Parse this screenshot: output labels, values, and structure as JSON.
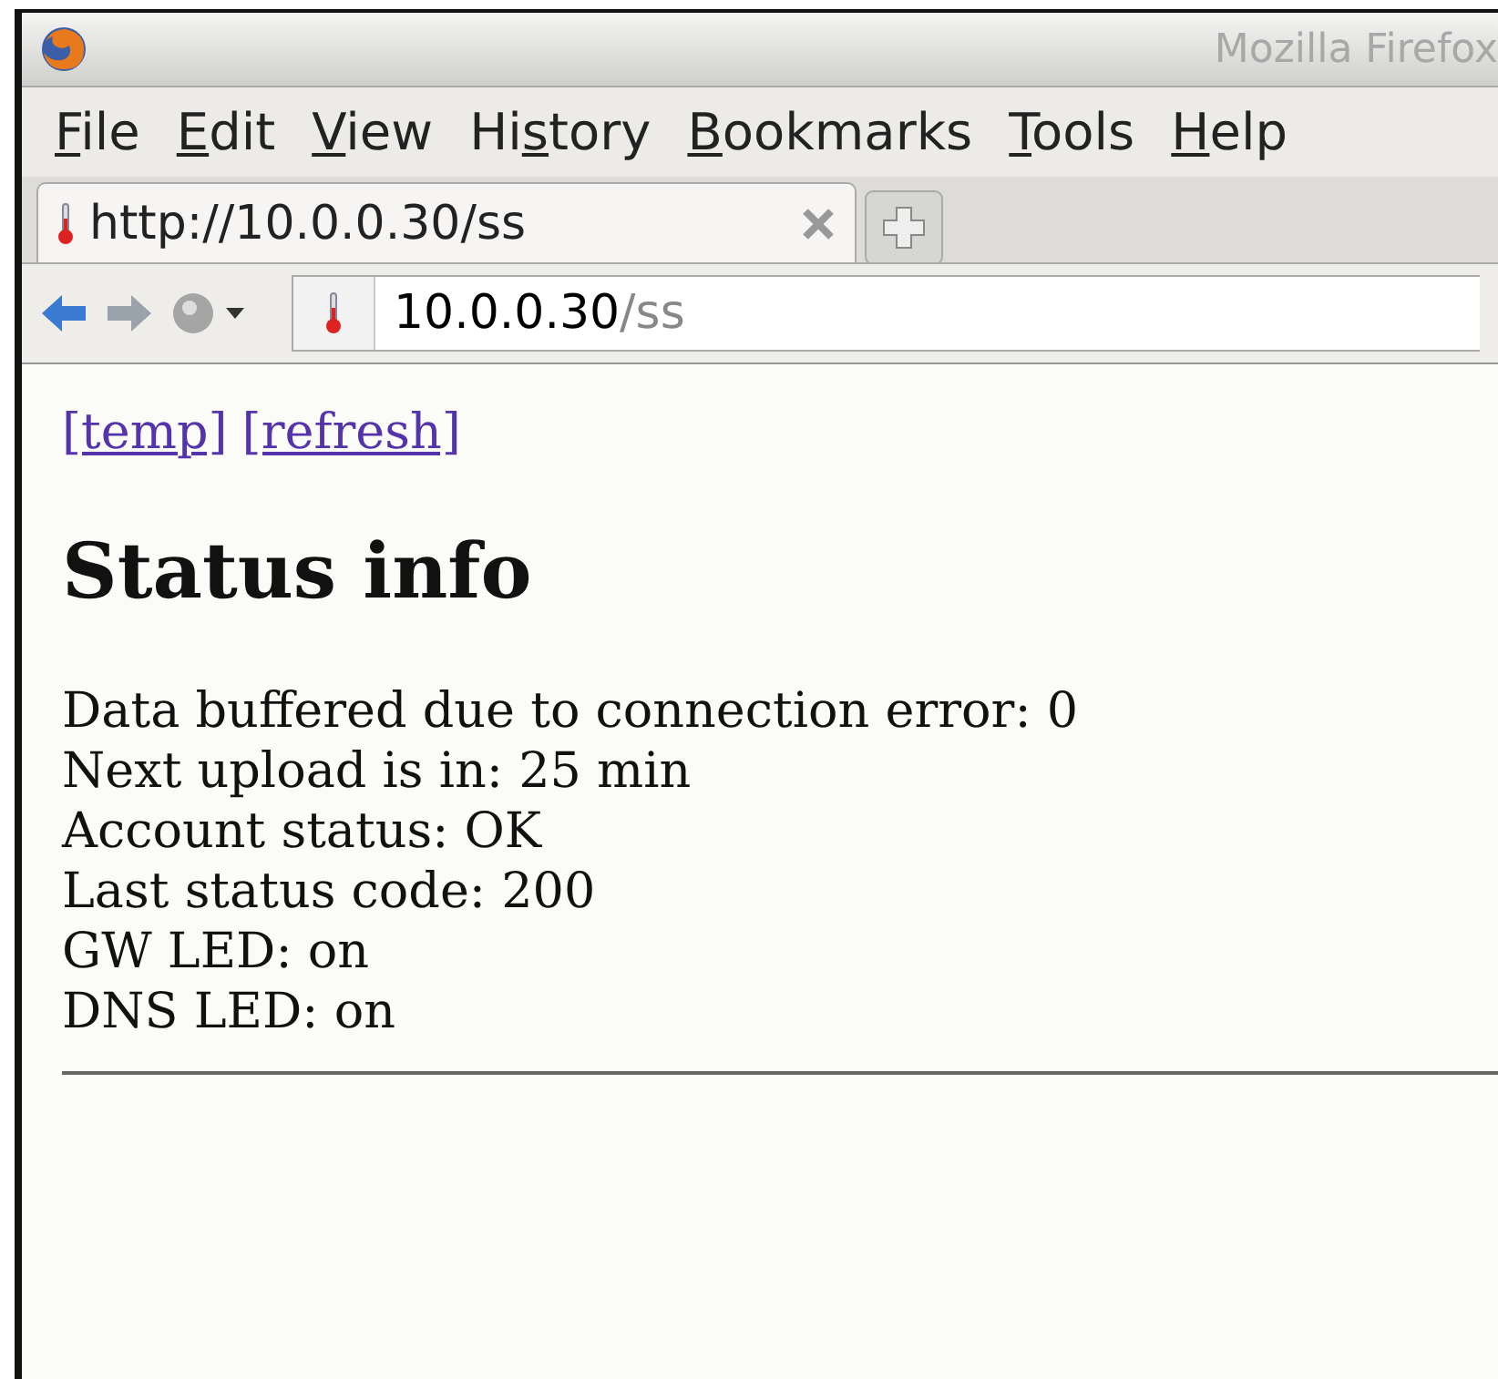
{
  "window": {
    "title": "Mozilla Firefox"
  },
  "menu": [
    {
      "parts": [
        {
          "text": "F",
          "underlined": true
        },
        {
          "text": "ile",
          "underlined": false
        }
      ]
    },
    {
      "parts": [
        {
          "text": "E",
          "underlined": true
        },
        {
          "text": "dit",
          "underlined": false
        }
      ]
    },
    {
      "parts": [
        {
          "text": "V",
          "underlined": true
        },
        {
          "text": "iew",
          "underlined": false
        }
      ]
    },
    {
      "parts": [
        {
          "text": "Hi",
          "underlined": false
        },
        {
          "text": "s",
          "underlined": true
        },
        {
          "text": "tory",
          "underlined": false
        }
      ]
    },
    {
      "parts": [
        {
          "text": "B",
          "underlined": true
        },
        {
          "text": "ookmarks",
          "underlined": false
        }
      ]
    },
    {
      "parts": [
        {
          "text": "T",
          "underlined": true
        },
        {
          "text": "ools",
          "underlined": false
        }
      ]
    },
    {
      "parts": [
        {
          "text": "H",
          "underlined": true
        },
        {
          "text": "elp",
          "underlined": false
        }
      ]
    }
  ],
  "tabs": [
    {
      "label": "http://10.0.0.30/ss",
      "selected": true
    }
  ],
  "address": {
    "host": "10.0.0.30",
    "path": "/ss"
  },
  "page": {
    "links": [
      "[temp]",
      "[refresh]"
    ],
    "heading": "Status info",
    "lines": [
      "Data buffered due to connection error: 0",
      "Next upload is in: 25 min",
      "Account status: OK",
      "Last status code: 200",
      "GW LED: on",
      "DNS LED: on"
    ]
  }
}
